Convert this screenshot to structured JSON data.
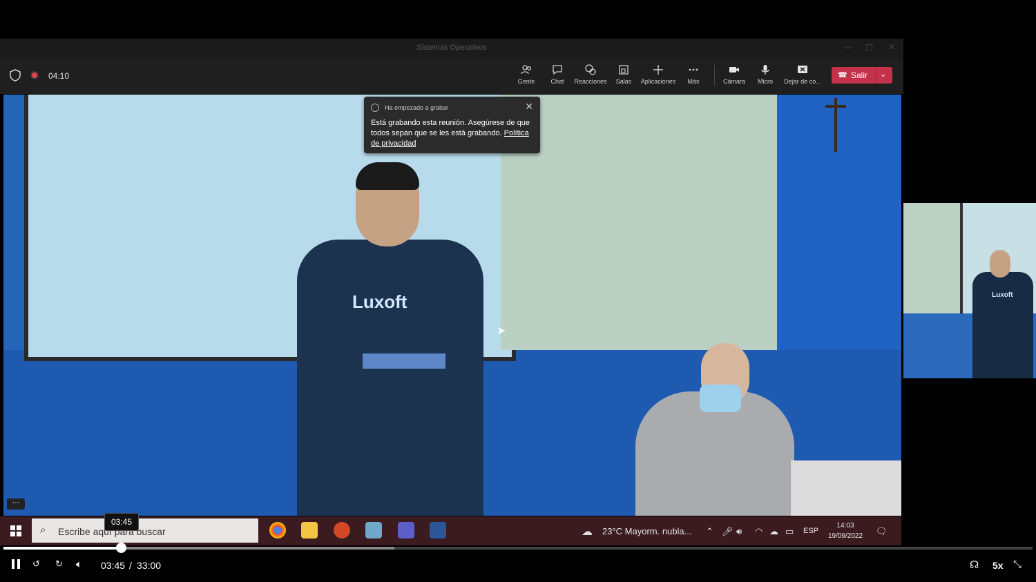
{
  "window": {
    "title": "Sistemas Operativos"
  },
  "meeting": {
    "timer": "04:10"
  },
  "toolbar": {
    "people": "Gente",
    "chat": "Chat",
    "reactions": "Reacciones",
    "rooms": "Salas",
    "apps": "Aplicaciones",
    "more": "Más",
    "camera": "Cámara",
    "mic": "Micro",
    "share": "Dejar de co...",
    "leave": "Salir"
  },
  "toast": {
    "header": "Ha empezado a grabar",
    "message": "Está grabando esta reunión. Asegúrese de que todos sepan que se les está grabando.",
    "link": "Política de privacidad"
  },
  "video": {
    "shirt_logo": "Luxoft"
  },
  "taskbar": {
    "search_placeholder": "Escribe aquí para buscar",
    "weather": "23°C  Mayorm. nubla...",
    "language": "ESP",
    "time": "14:03",
    "date": "19/09/2022"
  },
  "player": {
    "tooltip_time": "03:45",
    "current_time": "03:45",
    "separator": "/",
    "duration": "33:00",
    "speed": "5x",
    "progress": 0.114,
    "buffered": 0.38
  },
  "colors": {
    "leave": "#c4314b",
    "taskbar": "#3b1a20",
    "record": "#e0404e"
  }
}
